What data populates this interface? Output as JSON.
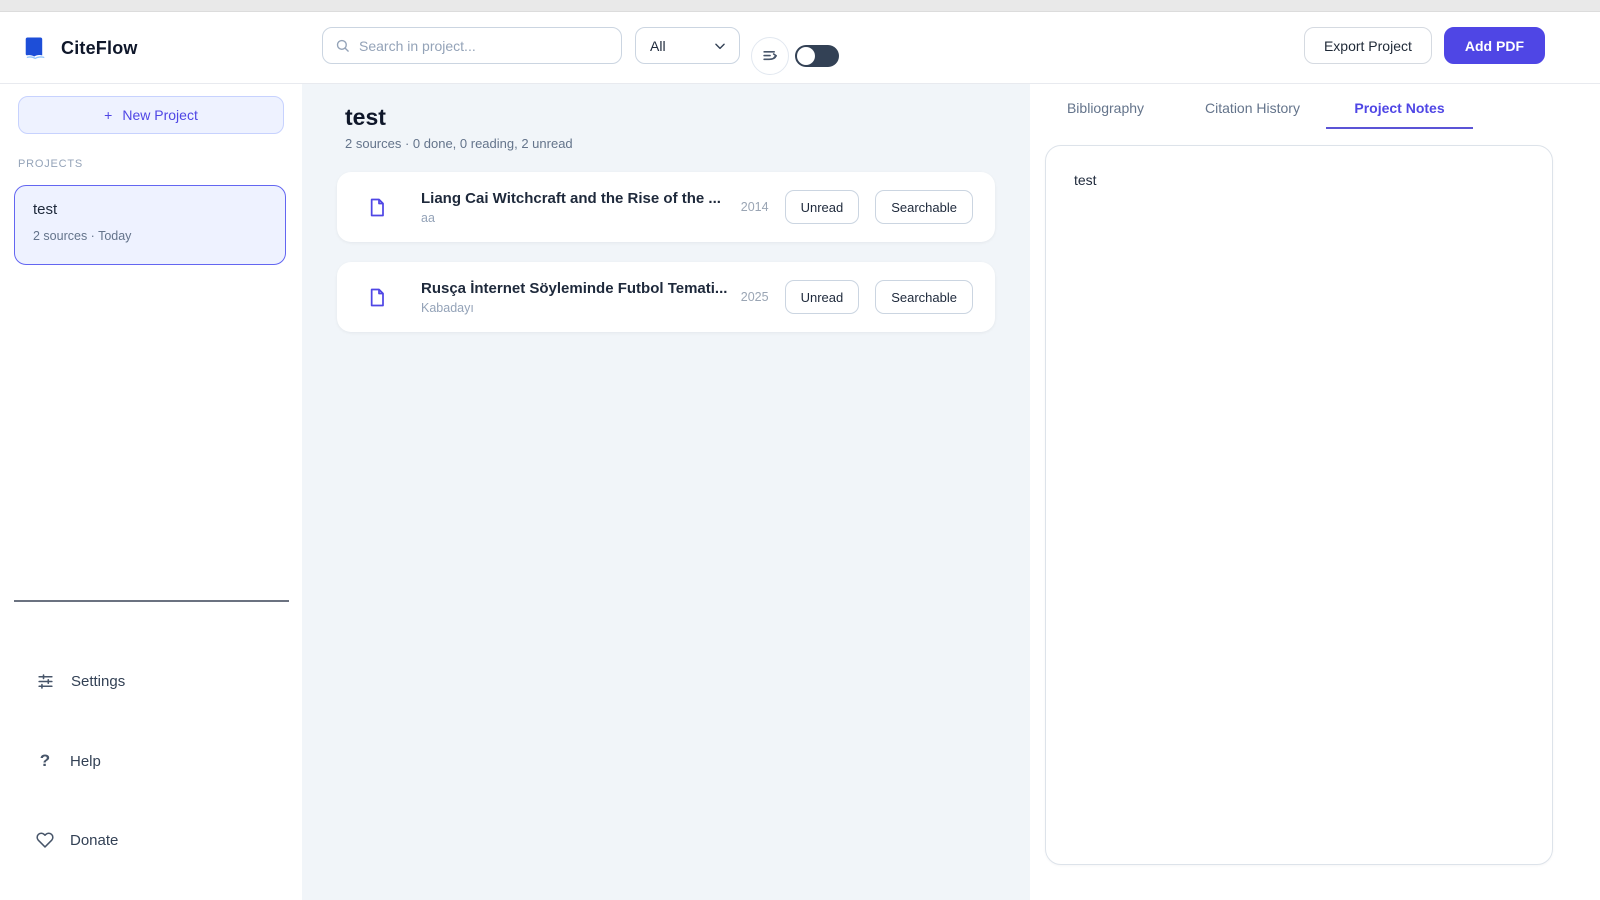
{
  "app": {
    "name": "CiteFlow"
  },
  "header": {
    "search": {
      "placeholder": "Search in project..."
    },
    "filter": {
      "value": "All"
    },
    "buttons": {
      "export": "Export Project",
      "add_pdf": "Add PDF"
    }
  },
  "sidebar": {
    "new_project": {
      "plus": "+",
      "label": "New Project"
    },
    "projects_heading": "PROJECTS",
    "projects": [
      {
        "name": "test",
        "meta": "2 sources · Today"
      }
    ],
    "footer": [
      {
        "label": "Settings",
        "icon": "sliders-icon"
      },
      {
        "label": "Help",
        "icon": "question-icon",
        "glyph": "?"
      },
      {
        "label": "Donate",
        "icon": "heart-icon"
      }
    ]
  },
  "main": {
    "title": "test",
    "subtitle": "2 sources · 0 done, 0 reading, 2 unread",
    "sources": [
      {
        "title": "Liang Cai Witchcraft and the Rise of the ...",
        "author": "aa",
        "year": "2014",
        "status_label": "Unread",
        "badge_label": "Searchable"
      },
      {
        "title": "Rusça İnternet Söyleminde Futbol Temati...",
        "author": "Kabadayı",
        "year": "2025",
        "status_label": "Unread",
        "badge_label": "Searchable"
      }
    ]
  },
  "right_panel": {
    "tabs": [
      {
        "label": "Bibliography",
        "active": false
      },
      {
        "label": "Citation History",
        "active": false
      },
      {
        "label": "Project Notes",
        "active": true
      }
    ],
    "notes": {
      "value": "test"
    }
  },
  "icons": {
    "logo": "book-icon",
    "search": "search-icon",
    "filter": "chevron-down-icon",
    "sort": "sort-lines-icon",
    "toggle": "theme-toggle",
    "source": "file-icon",
    "settings": "sliders-icon",
    "help": "question-icon",
    "donate": "heart-icon"
  },
  "colors": {
    "accent": "#4f46e5",
    "accent_light": "#eef2ff",
    "accent_border": "#6366f1",
    "toggle_track": "#334155",
    "main_background": "#f1f5f9",
    "text_dark": "#0f172a",
    "text_muted": "#64748b",
    "text_faint": "#94a3b8",
    "border": "#e2e8f0"
  }
}
